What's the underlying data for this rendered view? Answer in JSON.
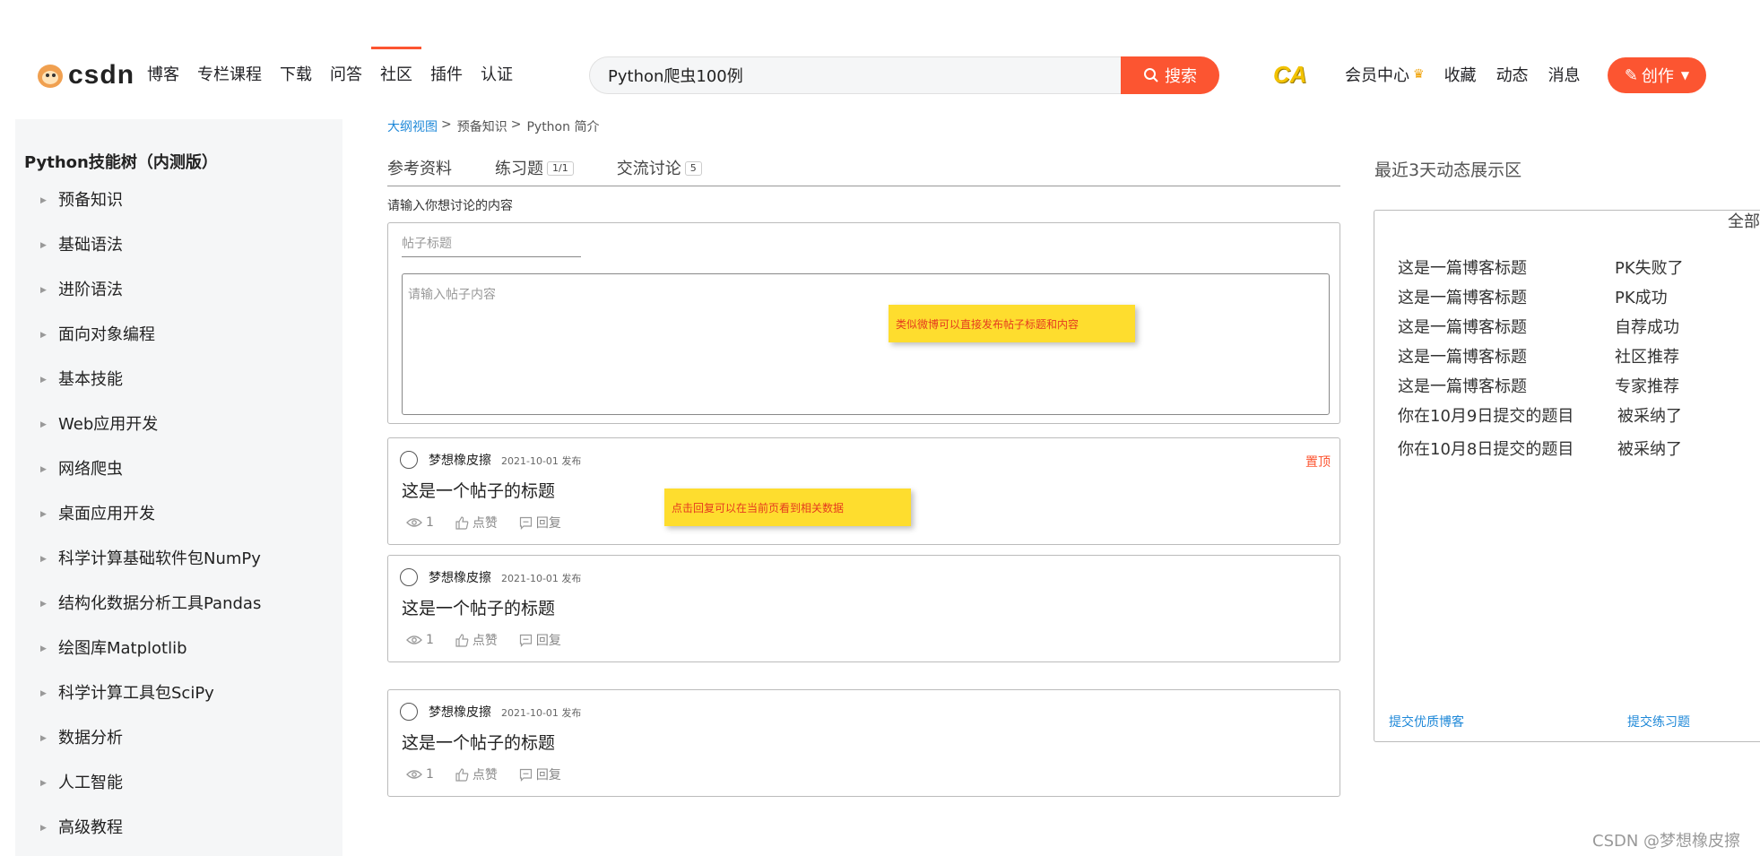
{
  "header": {
    "logo_text_a": "cs",
    "logo_text_b": "d",
    "logo_text_c": "n",
    "nav": [
      "博客",
      "专栏课程",
      "下载",
      "问答",
      "社区",
      "插件",
      "认证"
    ],
    "active_nav": "社区",
    "search_value": "Python爬虫100例",
    "search_button": "搜索",
    "ca_icon": "CA",
    "right_links": [
      "会员中心",
      "收藏",
      "动态",
      "消息"
    ],
    "create_button": "创作"
  },
  "sidebar": {
    "title": "Python技能树（内测版）",
    "items": [
      "预备知识",
      "基础语法",
      "进阶语法",
      "面向对象编程",
      "基本技能",
      "Web应用开发",
      "网络爬虫",
      "桌面应用开发",
      "科学计算基础软件包NumPy",
      "结构化数据分析工具Pandas",
      "绘图库Matplotlib",
      "科学计算工具包SciPy",
      "数据分析",
      "人工智能",
      "高级教程"
    ]
  },
  "breadcrumb": {
    "items": [
      "大纲视图",
      "预备知识",
      "Python 简介"
    ],
    "separator": ">"
  },
  "tabs": {
    "reference": "参考资料",
    "exercises": "练习题",
    "exercises_badge": "1/1",
    "discussion": "交流讨论",
    "discussion_badge": "5"
  },
  "form": {
    "prompt": "请输入你想讨论的内容",
    "title_placeholder": "帖子标题",
    "content_placeholder": "请输入帖子内容"
  },
  "notes": {
    "form_note": "类似微博可以直接发布帖子标题和内容",
    "reply_note": "点击回复可以在当前页看到相关数据"
  },
  "posts": [
    {
      "author": "梦想橡皮擦",
      "date": "2021-10-01 发布",
      "title": "这是一个帖子的标题",
      "views": "1",
      "like": "点赞",
      "reply": "回复",
      "pin": "置顶"
    },
    {
      "author": "梦想橡皮擦",
      "date": "2021-10-01 发布",
      "title": "这是一个帖子的标题",
      "views": "1",
      "like": "点赞",
      "reply": "回复"
    },
    {
      "author": "梦想橡皮擦",
      "date": "2021-10-01 发布",
      "title": "这是一个帖子的标题",
      "views": "1",
      "like": "点赞",
      "reply": "回复"
    }
  ],
  "right_panel": {
    "title": "最近3天动态展示区",
    "all": "全部",
    "activities": [
      {
        "title": "这是一篇博客标题",
        "status": "PK失败了"
      },
      {
        "title": "这是一篇博客标题",
        "status": "PK成功"
      },
      {
        "title": "这是一篇博客标题",
        "status": "自荐成功"
      },
      {
        "title": "这是一篇博客标题",
        "status": "社区推荐"
      },
      {
        "title": "这是一篇博客标题",
        "status": "专家推荐"
      },
      {
        "title": "你在10月9日提交的题目",
        "status": "被采纳了"
      },
      {
        "title": "你在10月8日提交的题目",
        "status": "被采纳了"
      }
    ],
    "submit_blog": "提交优质博客",
    "submit_exercise": "提交练习题"
  },
  "watermark": "CSDN @梦想橡皮擦",
  "colors": {
    "brand": "#fc5531",
    "link": "#1e88d8",
    "note_bg": "#fedd2e",
    "sidebar_bg": "#f5f6f7"
  }
}
